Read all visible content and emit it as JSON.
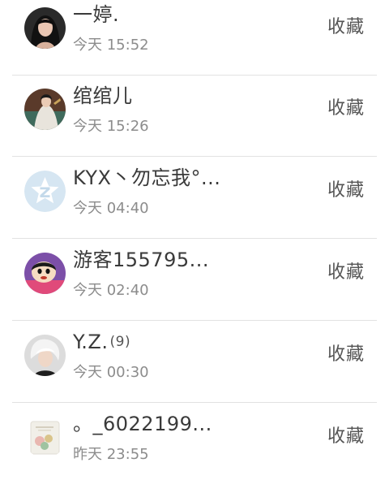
{
  "contacts": [
    {
      "name": "一婷.",
      "count": "",
      "time": "今天 15:52",
      "action": "收藏",
      "avatar_icon": "portrait-girl-dark-hair"
    },
    {
      "name": "绾绾儿",
      "count": "",
      "time": "今天 15:26",
      "action": "收藏",
      "avatar_icon": "portrait-costume-figure"
    },
    {
      "name": "KYX丶勿忘我°...",
      "count": "",
      "time": "今天 04:40",
      "action": "收藏",
      "avatar_icon": "default-z-star-avatar"
    },
    {
      "name": "游客155795...",
      "count": "",
      "time": "今天 02:40",
      "action": "收藏",
      "avatar_icon": "cartoon-boy-avatar"
    },
    {
      "name": "Y.Z.",
      "count": "(9)",
      "time": "今天 00:30",
      "action": "收藏",
      "avatar_icon": "portrait-white-hair"
    },
    {
      "name": "。_6022199...",
      "count": "",
      "time": "昨天 23:55",
      "action": "收藏",
      "avatar_icon": "flower-card-avatar"
    }
  ],
  "colors": {
    "name_text": "#3a3a3a",
    "time_text": "#8c8c8c",
    "action_text": "#555555",
    "divider": "#e2e2e2",
    "default_avatar_bg": "#d6e6f2"
  }
}
